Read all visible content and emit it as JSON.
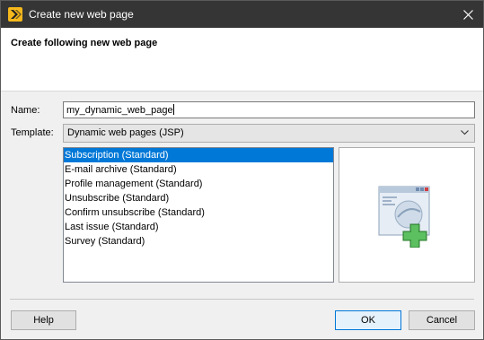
{
  "window": {
    "title": "Create new web page"
  },
  "header": {
    "title": "Create following new web page"
  },
  "form": {
    "name_label": "Name:",
    "name_value": "my_dynamic_web_page",
    "template_label": "Template:",
    "template_value": "Dynamic web pages (JSP)"
  },
  "templates": [
    "Subscription (Standard)",
    "E-mail archive (Standard)",
    "Profile management (Standard)",
    "Unsubscribe (Standard)",
    "Confirm unsubscribe (Standard)",
    "Last issue (Standard)",
    "Survey (Standard)"
  ],
  "selected_template_index": 0,
  "buttons": {
    "help": "Help",
    "ok": "OK",
    "cancel": "Cancel"
  },
  "colors": {
    "titlebar": "#353535",
    "selection": "#0078d7",
    "accent": "#f5b81c",
    "plus": "#4caf50"
  },
  "icons": {
    "app": "app-logo-icon",
    "close": "close-icon",
    "dropdown": "chevron-down-icon",
    "preview": "new-web-page-icon"
  }
}
